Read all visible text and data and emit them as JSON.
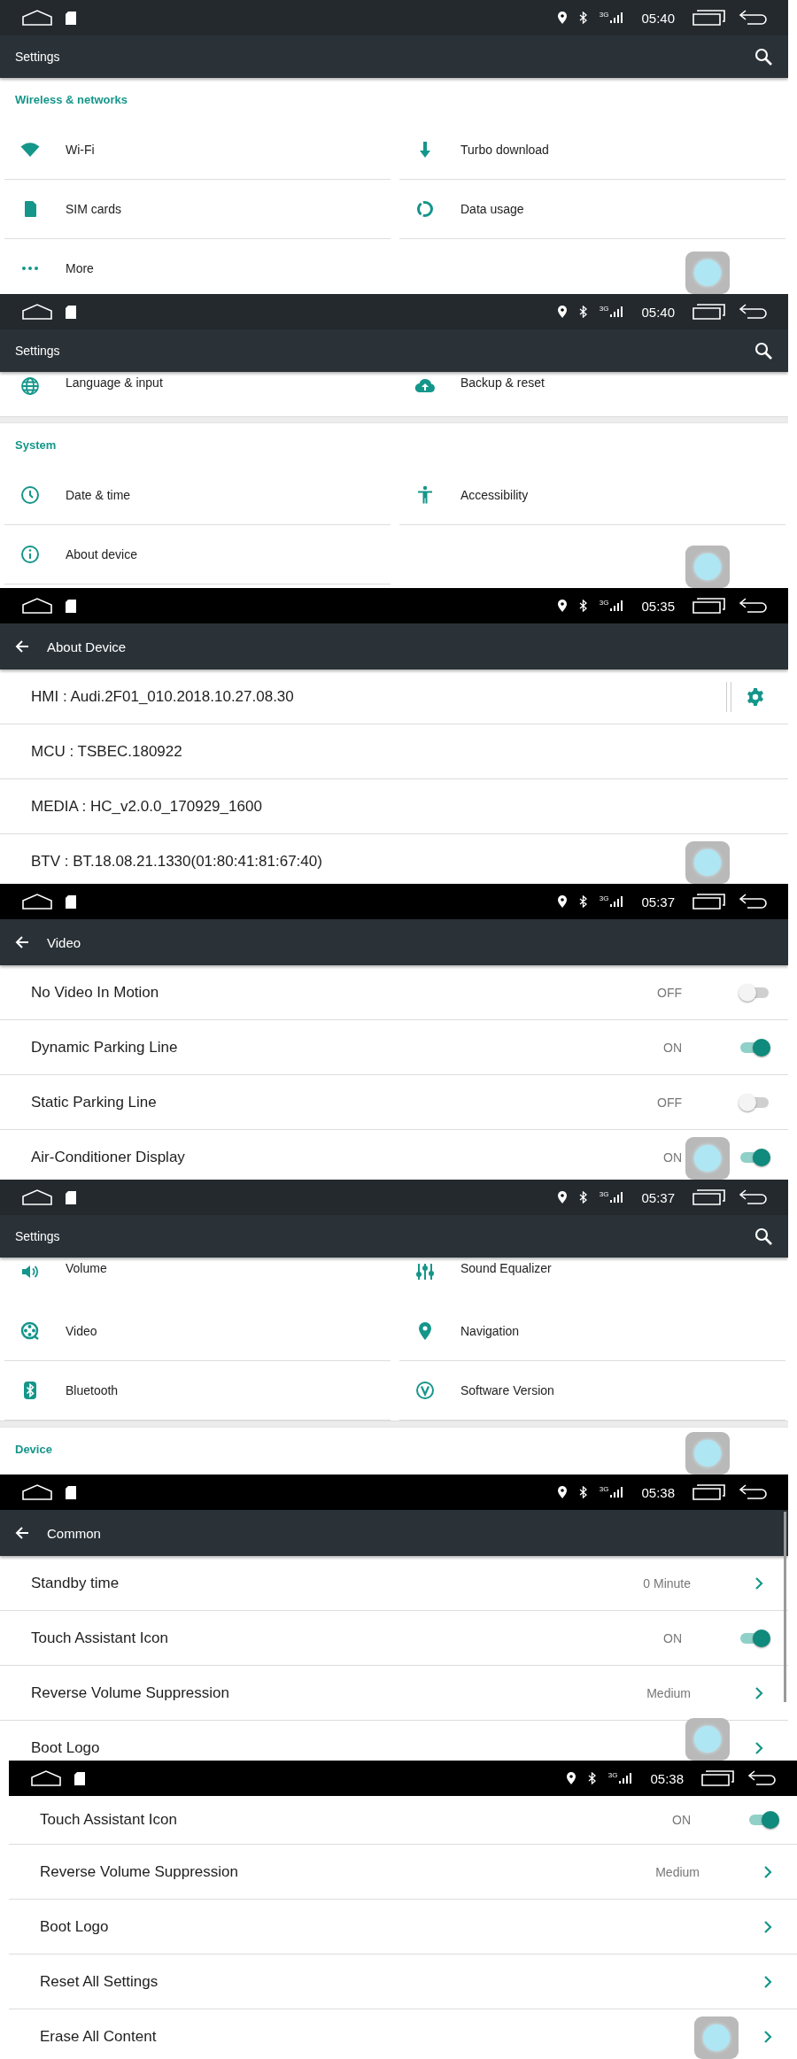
{
  "screens": [
    {
      "kind": "grid",
      "status_bar": {
        "network": "3G",
        "time": "05:40"
      },
      "toolbar": {
        "title": "Settings",
        "back": false,
        "search": true
      },
      "blocks": [
        {
          "kind": "section",
          "title": "Wireless & networks"
        },
        {
          "kind": "row",
          "cells": [
            {
              "label": "Wi-Fi"
            },
            {
              "label": "Turbo download"
            }
          ]
        },
        {
          "kind": "row",
          "cells": [
            {
              "label": "SIM cards"
            },
            {
              "label": "Data usage"
            }
          ]
        },
        {
          "kind": "row",
          "cells": [
            {
              "label": "More"
            }
          ]
        }
      ]
    },
    {
      "kind": "grid",
      "status_bar": {
        "network": "3G",
        "time": "05:40"
      },
      "toolbar": {
        "title": "Settings",
        "back": false,
        "search": true
      },
      "blocks": [
        {
          "kind": "row",
          "cells": [
            {
              "label": "Language & input"
            },
            {
              "label": "Backup & reset"
            }
          ]
        },
        {
          "kind": "section",
          "title": "System"
        },
        {
          "kind": "row",
          "cells": [
            {
              "label": "Date & time"
            },
            {
              "label": "Accessibility"
            }
          ]
        },
        {
          "kind": "row",
          "cells": [
            {
              "label": "About device"
            }
          ]
        }
      ]
    },
    {
      "kind": "list",
      "status_bar": {
        "network": "3G",
        "time": "05:35"
      },
      "toolbar": {
        "title": "About Device",
        "back": true,
        "search": false
      },
      "rows": [
        {
          "kind": "gear",
          "label": "HMI : Audi.2F01_010.2018.10.27.08.30"
        },
        {
          "kind": "plain",
          "label": "MCU : TSBEC.180922"
        },
        {
          "kind": "plain",
          "label": "MEDIA : HC_v2.0.0_170929_1600"
        },
        {
          "kind": "plain",
          "label": "BTV : BT.18.08.21.1330(01:80:41:81:67:40)"
        }
      ]
    },
    {
      "kind": "list",
      "status_bar": {
        "network": "3G",
        "time": "05:37"
      },
      "toolbar": {
        "title": "Video",
        "back": true,
        "search": false
      },
      "rows": [
        {
          "kind": "toggle",
          "label": "No Video In Motion",
          "value": "OFF",
          "on": false
        },
        {
          "kind": "toggle",
          "label": "Dynamic Parking Line",
          "value": "ON",
          "on": true
        },
        {
          "kind": "toggle",
          "label": "Static Parking Line",
          "value": "OFF",
          "on": false
        },
        {
          "kind": "toggle",
          "label": "Air-Conditioner Display",
          "value": "ON",
          "on": true
        }
      ]
    },
    {
      "kind": "grid",
      "status_bar": {
        "network": "3G",
        "time": "05:37"
      },
      "toolbar": {
        "title": "Settings",
        "back": false,
        "search": true
      },
      "blocks": [
        {
          "kind": "row",
          "cells": [
            {
              "label": "Volume"
            },
            {
              "label": "Sound Equalizer"
            }
          ]
        },
        {
          "kind": "row",
          "cells": [
            {
              "label": "Video"
            },
            {
              "label": "Navigation"
            }
          ]
        },
        {
          "kind": "row",
          "cells": [
            {
              "label": "Bluetooth"
            },
            {
              "label": "Software Version"
            }
          ]
        },
        {
          "kind": "section",
          "title": "Device"
        }
      ]
    },
    {
      "kind": "list",
      "status_bar": {
        "network": "3G",
        "time": "05:38"
      },
      "toolbar": {
        "title": "Common",
        "back": true,
        "search": false
      },
      "scrollbar": true,
      "rows": [
        {
          "kind": "link",
          "label": "Standby time",
          "value": "0 Minute"
        },
        {
          "kind": "toggle",
          "label": "Touch Assistant Icon",
          "value": "ON",
          "on": true
        },
        {
          "kind": "link",
          "label": "Reverse Volume Suppression",
          "value": "Medium"
        },
        {
          "kind": "link",
          "label": "Boot Logo"
        }
      ]
    },
    {
      "kind": "list",
      "status_bar": {
        "network": "3G",
        "time": "05:38"
      },
      "rows": [
        {
          "kind": "toggle",
          "label": "Touch Assistant Icon",
          "value": "ON",
          "on": true
        },
        {
          "kind": "link",
          "label": "Reverse Volume Suppression",
          "value": "Medium"
        },
        {
          "kind": "link",
          "label": "Boot Logo"
        },
        {
          "kind": "link",
          "label": "Reset All Settings"
        },
        {
          "kind": "link",
          "label": "Erase All Content"
        }
      ]
    }
  ]
}
